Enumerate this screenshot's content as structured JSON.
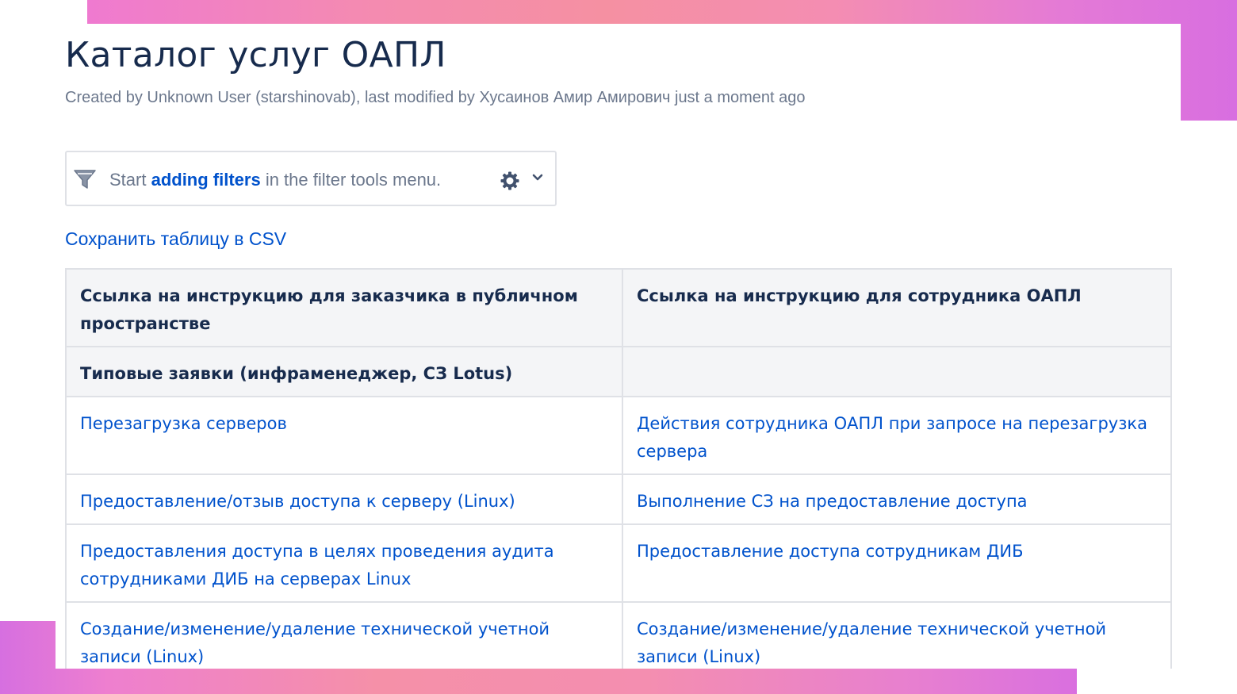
{
  "page": {
    "title": "Каталог услуг ОАПЛ",
    "meta": "Created by Unknown User (starshinovab), last modified by Хусаинов Амир Амирович just a moment ago"
  },
  "filter": {
    "prefix": "Start ",
    "link": "adding filters",
    "suffix": " in the filter tools menu.",
    "icons": [
      "funnel-icon",
      "gear-icon",
      "chevron-down-icon"
    ]
  },
  "csv_link": "Сохранить таблицу в CSV",
  "table": {
    "headers": [
      "Ссылка на инструкцию для заказчика в публичном пространстве",
      "Ссылка на инструкцию для сотрудника ОАПЛ"
    ],
    "group_row": [
      "Типовые заявки (инфраменеджер, СЗ Lotus)",
      ""
    ],
    "rows": [
      [
        "Перезагрузка серверов",
        "Действия сотрудника ОАПЛ при запросе на перезагрузка сервера"
      ],
      [
        "Предоставление/отзыв доступа к серверу (Linux)",
        "Выполнение СЗ на предоставление доступа"
      ],
      [
        "Предоставления доступа в целях проведения аудита сотрудниками ДИБ на серверах Linux",
        "Предоставление доступа сотрудникам ДИБ"
      ],
      [
        "Создание/изменение/удаление технической учетной записи (Linux)",
        "Создание/изменение/удаление технической учетной записи (Linux)"
      ]
    ]
  },
  "colors": {
    "link": "#0052cc",
    "heading": "#172b4d",
    "muted": "#6b778c",
    "header_bg": "#f4f5f7",
    "border": "#dfe1e6",
    "gradient_pink": "#f590a2",
    "gradient_purple": "#d86ee0"
  }
}
